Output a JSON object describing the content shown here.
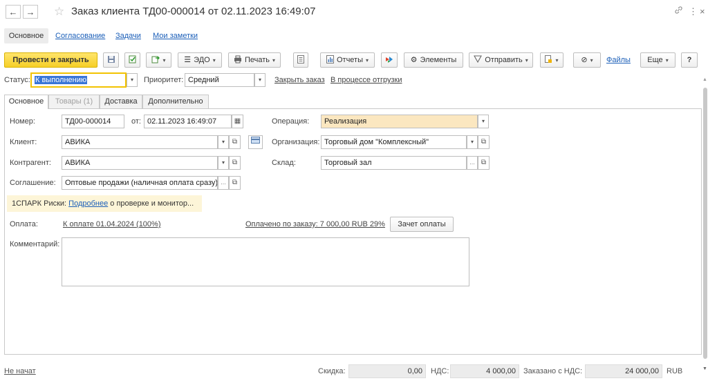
{
  "window": {
    "title": "Заказ клиента ТД00-000014 от 02.11.2023 16:49:07",
    "back": "←",
    "forward": "→",
    "star": "☆",
    "link_icon": "🔗",
    "more_icon": "⋮",
    "close_icon": "×"
  },
  "sections": {
    "main": "Основное",
    "approval": "Согласование",
    "tasks": "Задачи",
    "notes": "Мои заметки"
  },
  "toolbar": {
    "post_close": "Провести и закрыть",
    "edo": "ЭДО",
    "print": "Печать",
    "reports": "Отчеты",
    "elements": "Элементы",
    "send": "Отправить",
    "files": "Файлы",
    "more": "Еще",
    "help": "?"
  },
  "status_row": {
    "status_label": "Статус:",
    "status_value": "К выполнению",
    "priority_label": "Приоритет:",
    "priority_value": "Средний",
    "close_order_link": "Закрыть заказ",
    "shipping_link": "В процессе отгрузки"
  },
  "tabs": {
    "main": "Основное",
    "goods": "Товары (1)",
    "delivery": "Доставка",
    "additional": "Дополнительно"
  },
  "form": {
    "number_label": "Номер:",
    "number_value": "ТД00-000014",
    "date_label": "от:",
    "date_value": "02.11.2023 16:49:07",
    "operation_label": "Операция:",
    "operation_value": "Реализация",
    "client_label": "Клиент:",
    "client_value": "АВИКА",
    "org_label": "Организация:",
    "org_value": "Торговый дом \"Комплексный\"",
    "counterparty_label": "Контрагент:",
    "counterparty_value": "АВИКА",
    "warehouse_label": "Склад:",
    "warehouse_value": "Торговый зал",
    "agreement_label": "Соглашение:",
    "agreement_value": "Оптовые продажи (наличная оплата сразу)",
    "risk_prefix": "1СПАРК Риски:",
    "risk_link": "Подробнее",
    "risk_suffix": "о проверке и монитор...",
    "payment_label": "Оплата:",
    "payment_link": "К оплате 01.04.2024 (100%)",
    "paid_link": "Оплачено по заказу: 7 000,00 RUB 29%",
    "offset_button": "Зачет оплаты",
    "comment_label": "Комментарий:"
  },
  "footer": {
    "status_link": "Не начат",
    "discount_label": "Скидка:",
    "discount_value": "0,00",
    "vat_label": "НДС:",
    "vat_value": "4 000,00",
    "ordered_label": "Заказано с НДС:",
    "ordered_value": "24 000,00",
    "currency": "RUB"
  }
}
